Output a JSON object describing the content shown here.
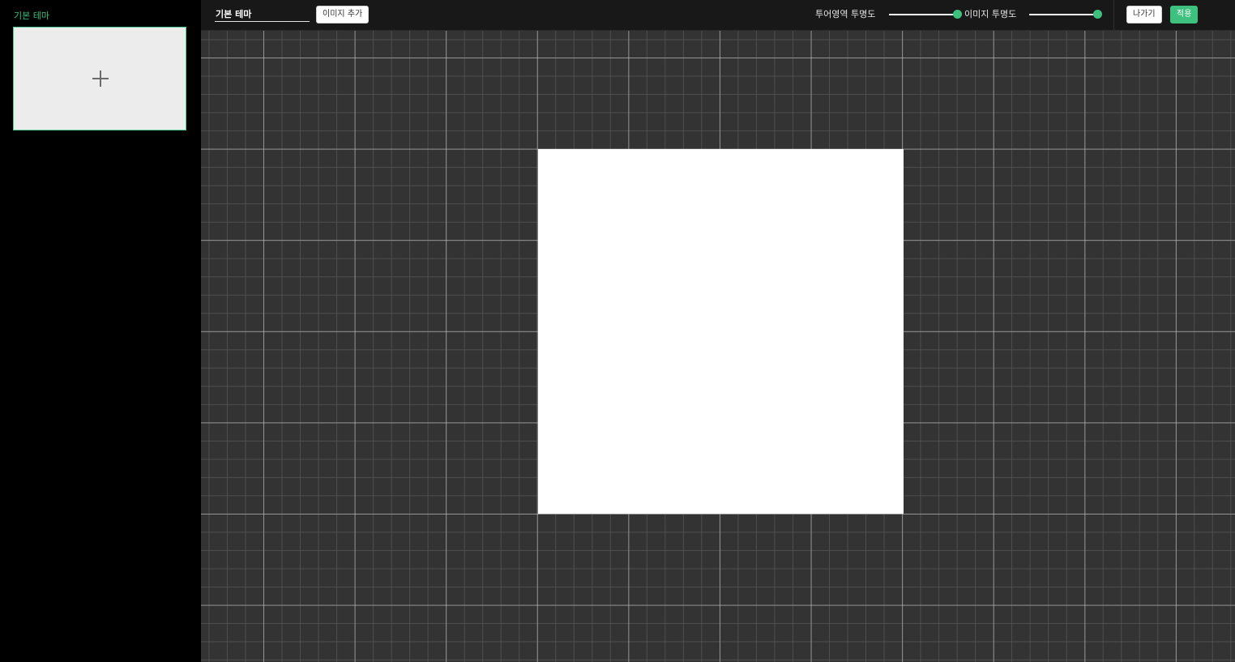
{
  "sidebar": {
    "theme_label": "기본 테마",
    "theme_card": {
      "icon": "plus-icon"
    }
  },
  "toolbar": {
    "theme_name_value": "기본 테마",
    "add_image_label": "이미지 추가",
    "tour_opacity": {
      "label": "투어영역 투명도",
      "value": 1.0
    },
    "image_opacity": {
      "label": "이미지 투명도",
      "value": 1.0
    },
    "exit_label": "나가기",
    "apply_label": "적용"
  },
  "colors": {
    "accent": "#3ec17f",
    "canvas_background": "#333333",
    "sidebar_background": "#000000",
    "toolbar_background": "#181818",
    "tour_area": "#ffffff"
  }
}
